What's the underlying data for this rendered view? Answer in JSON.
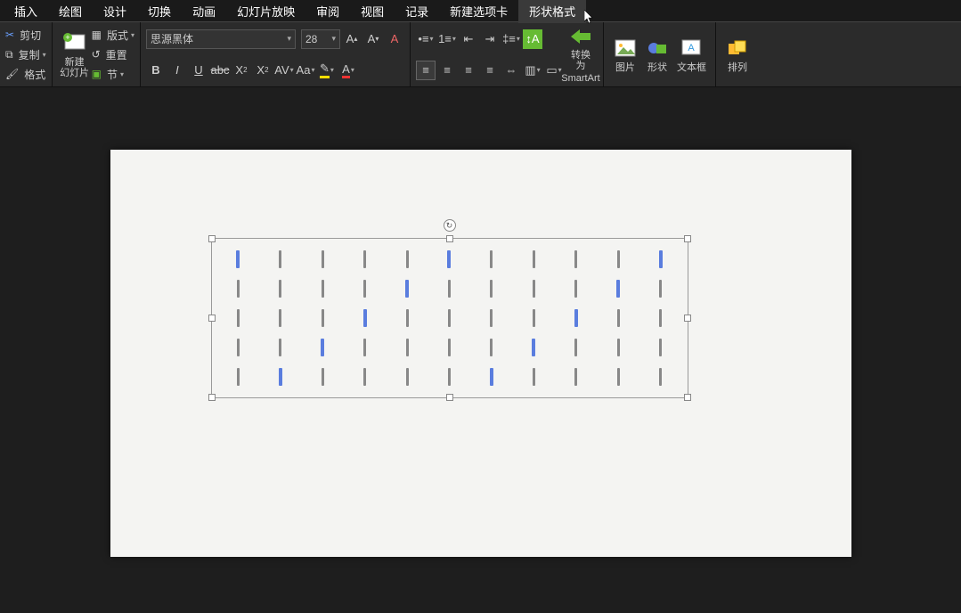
{
  "menu": {
    "items": [
      "插入",
      "绘图",
      "设计",
      "切换",
      "动画",
      "幻灯片放映",
      "审阅",
      "视图",
      "记录",
      "新建选项卡",
      "形状格式"
    ],
    "activeIndex": 10
  },
  "clipboard": {
    "cut": "剪切",
    "copy": "复制",
    "format": "格式"
  },
  "slides": {
    "new": "新建\n幻灯片",
    "layout": "版式",
    "reset": "重置",
    "section": "节"
  },
  "font": {
    "name": "思源黑体",
    "size": "28"
  },
  "smartart": {
    "convert": "转换为",
    "convert2": "SmartArt"
  },
  "media": {
    "pic": "图片",
    "shape": "形状",
    "textbox": "文本框",
    "arrange": "排列"
  },
  "chart_data": {
    "type": "bar",
    "rows": 5,
    "cols": 11,
    "blue_cells": [
      [
        0,
        0
      ],
      [
        0,
        5
      ],
      [
        0,
        10
      ],
      [
        1,
        4
      ],
      [
        1,
        9
      ],
      [
        2,
        3
      ],
      [
        2,
        8
      ],
      [
        3,
        2
      ],
      [
        3,
        7
      ],
      [
        4,
        1
      ],
      [
        4,
        6
      ],
      [
        0,
        0
      ]
    ],
    "note": "blue diagonal pattern inside selected text box"
  }
}
